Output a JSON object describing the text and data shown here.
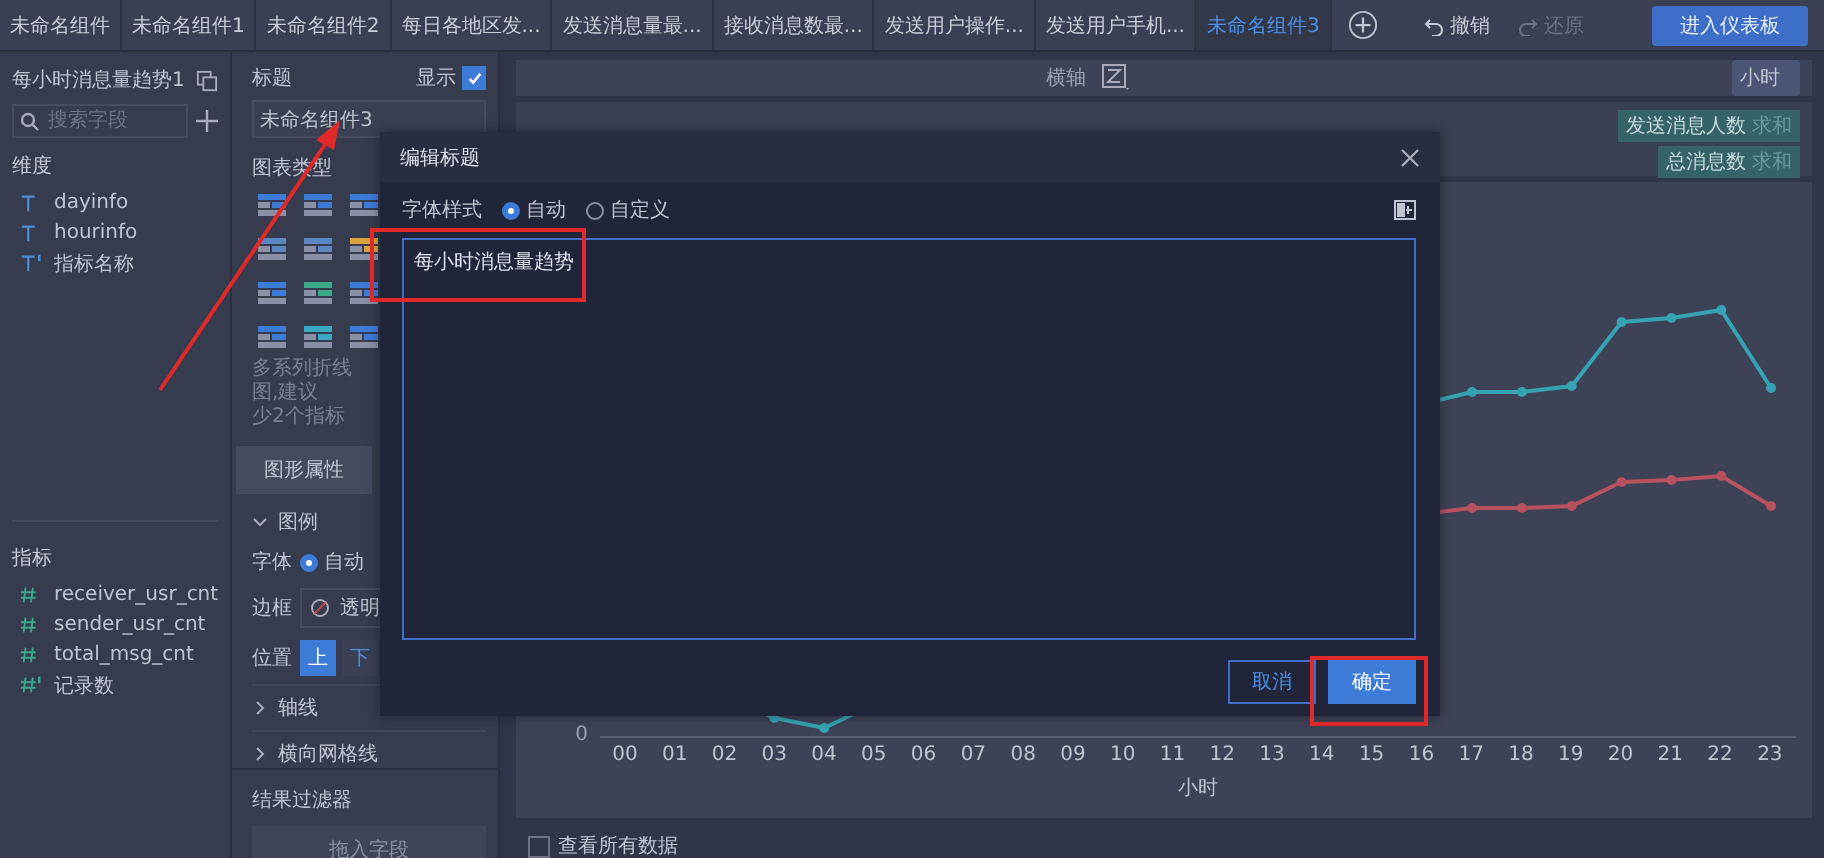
{
  "tabs": [
    {
      "label": "未命名组件",
      "selected": false
    },
    {
      "label": "未命名组件1",
      "selected": false
    },
    {
      "label": "未命名组件2",
      "selected": false
    },
    {
      "label": "每日各地区发...",
      "selected": false
    },
    {
      "label": "发送消息量最...",
      "selected": false
    },
    {
      "label": "接收消息数最...",
      "selected": false
    },
    {
      "label": "发送用户操作...",
      "selected": false
    },
    {
      "label": "发送用户手机...",
      "selected": false
    },
    {
      "label": "未命名组件3",
      "selected": true
    }
  ],
  "toolbar": {
    "undo": {
      "label": "撤销",
      "disabled": false
    },
    "redo": {
      "label": "还原",
      "disabled": true
    },
    "dashboard_button": "进入仪表板"
  },
  "field_panel": {
    "title": "每小时消息量趋势1",
    "search": {
      "placeholder": "搜索字段"
    },
    "dimensions": {
      "heading": "维度",
      "items": [
        {
          "name": "dayinfo",
          "calculated": false
        },
        {
          "name": "hourinfo",
          "calculated": false
        },
        {
          "name": "指标名称",
          "calculated": true
        }
      ]
    },
    "measures": {
      "heading": "指标",
      "items": [
        {
          "name": "receiver_usr_cnt",
          "calculated": false
        },
        {
          "name": "sender_usr_cnt",
          "calculated": false
        },
        {
          "name": "total_msg_cnt",
          "calculated": false
        },
        {
          "name": "记录数",
          "calculated": true
        }
      ]
    }
  },
  "settings_panel": {
    "title_label": "标题",
    "show": {
      "label": "显示",
      "checked": true
    },
    "title_input": {
      "value": "未命名组件3"
    },
    "chart_type_label": "图表类型",
    "chart_type_hint": [
      "多系列折线图,建议",
      "少2个指标"
    ],
    "tabs": [
      {
        "label": "图形属性",
        "selected": true
      }
    ],
    "legend": {
      "label": "图例",
      "expanded": true,
      "font": {
        "label": "字体",
        "options": [
          {
            "label": "自动",
            "selected": true
          }
        ]
      },
      "border": {
        "label": "边框",
        "value": "透明"
      },
      "position": {
        "label": "位置",
        "options": [
          {
            "label": "上",
            "selected": true
          },
          {
            "label": "下",
            "selected": false
          }
        ]
      }
    },
    "sections": [
      {
        "label": "轴线",
        "expanded": false
      },
      {
        "label": "横向网格线",
        "expanded": false
      }
    ],
    "result_filter": {
      "label": "结果过滤器",
      "dropzone": "拖入字段"
    }
  },
  "chart": {
    "x_axis_label": "横轴",
    "x_field": "小时",
    "legend": [
      {
        "label": "发送消息人数",
        "aggregate": "求和"
      },
      {
        "label": "总消息数",
        "aggregate": "求和"
      }
    ],
    "y_tick": "0",
    "x_labels": [
      "00",
      "01",
      "02",
      "03",
      "04",
      "05",
      "06",
      "07",
      "08",
      "09",
      "10",
      "11",
      "12",
      "13",
      "14",
      "15",
      "16",
      "17",
      "18",
      "19",
      "20",
      "21",
      "22",
      "23"
    ],
    "x_title": "小时",
    "show_all": {
      "label": "查看所有数据",
      "checked": false
    }
  },
  "dialog": {
    "title": "编辑标题",
    "font_style": {
      "label": "字体样式",
      "options": [
        {
          "label": "自动",
          "selected": true
        },
        {
          "label": "自定义",
          "selected": false
        }
      ]
    },
    "text": "每小时消息量趋势",
    "buttons": [
      {
        "label": "取消",
        "kind": "secondary"
      },
      {
        "label": "确定",
        "kind": "primary"
      }
    ]
  }
}
